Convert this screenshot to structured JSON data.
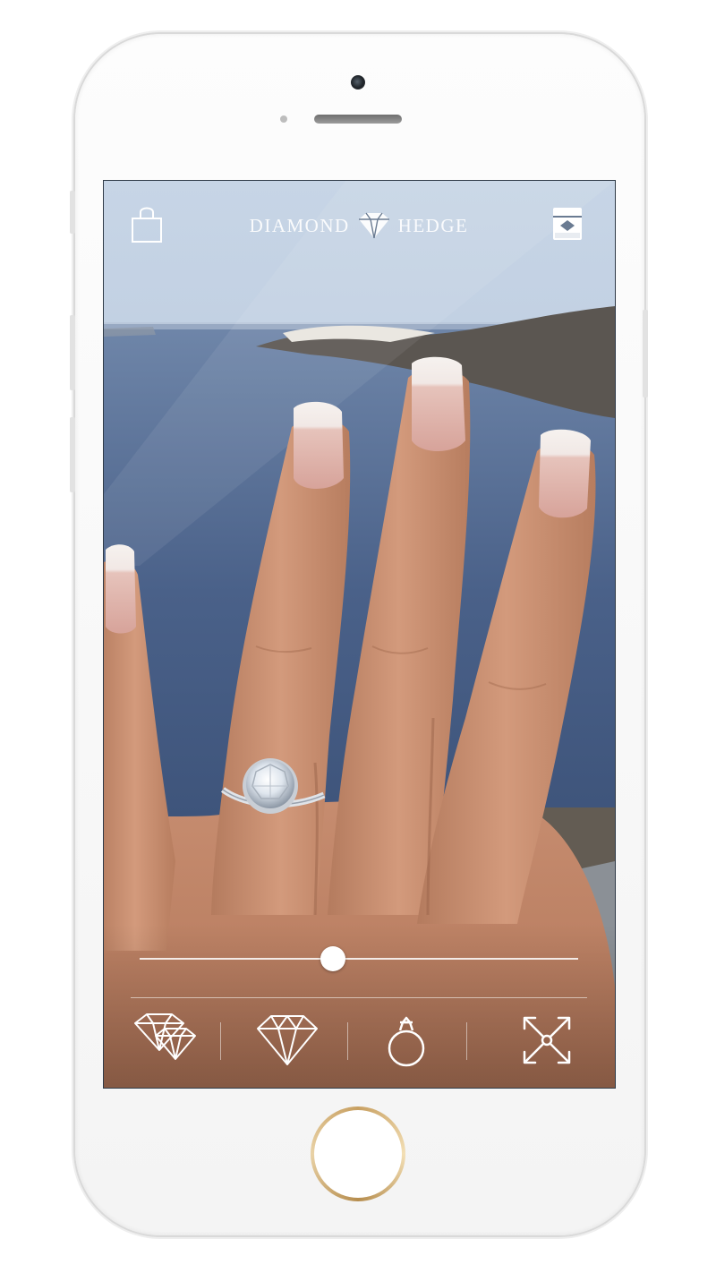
{
  "app": {
    "brand_left": "DIAMOND",
    "brand_right": "HEDGE"
  },
  "header": {
    "left_icon": "shopping-bag-icon",
    "right_icon": "ring-box-icon"
  },
  "slider": {
    "value": 0.44
  },
  "toolbar": {
    "items": [
      {
        "icon": "multiple-diamonds-icon"
      },
      {
        "icon": "diamond-icon"
      },
      {
        "icon": "ring-icon"
      },
      {
        "icon": "expand-arrows-icon"
      }
    ]
  },
  "colors": {
    "icon": "#ffffff",
    "sea": "#3e5679",
    "sky": "#b9c8dc",
    "home_button_ring": "#c8a062"
  }
}
